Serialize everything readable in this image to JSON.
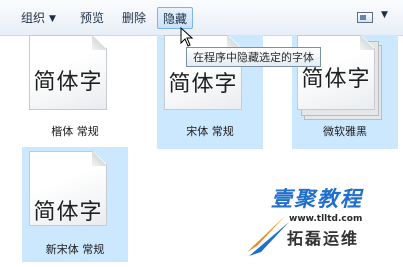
{
  "toolbar": {
    "organize_label": "组织",
    "preview_label": "预览",
    "delete_label": "删除",
    "hide_label": "隐藏"
  },
  "tooltip": "在程序中隐藏选定的字体",
  "fonts": [
    {
      "sample": "简体字",
      "name": "楷体 常规",
      "selected": false
    },
    {
      "sample": "简体字",
      "name": "宋体 常规",
      "selected": true
    },
    {
      "sample": "简体字",
      "name": "微软雅黑",
      "selected": true
    },
    {
      "sample": "简体字",
      "name": "新宋体 常规",
      "selected": true
    }
  ],
  "watermark": {
    "brand": "壹聚教程",
    "url": "www.tlltd.com",
    "subtitle": "拓磊运维"
  },
  "colors": {
    "selection": "#cce8ff",
    "watermark_blue": "#1f6fcf",
    "watermark_orange": "#f08a1c"
  }
}
